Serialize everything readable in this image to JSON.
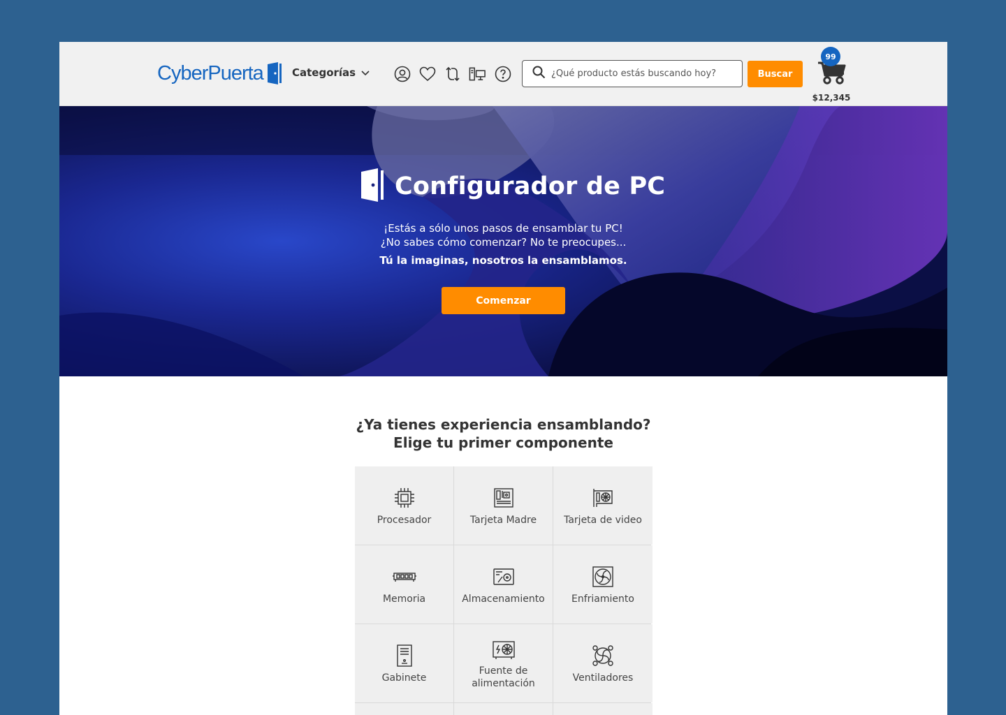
{
  "header": {
    "logo_text": "CyberPuerta",
    "categories_label": "Categorías",
    "icons": [
      "user-icon",
      "heart-icon",
      "compare-icon",
      "pc-config-icon",
      "help-icon"
    ],
    "search_placeholder": "¿Qué producto estás buscando hoy?",
    "search_button": "Buscar",
    "cart_count": "99",
    "cart_total": "$12,345"
  },
  "hero": {
    "title": "Configurador de PC",
    "line1": "¡Estás a sólo unos pasos de ensamblar tu PC!",
    "line2": "¿No sabes cómo comenzar? No te preocupes...",
    "line3": "Tú la imaginas, nosotros la ensamblamos.",
    "cta": "Comenzar"
  },
  "components": {
    "title_line1": "¿Ya tienes experiencia ensamblando?",
    "title_line2": "Elige tu primer componente",
    "items": [
      {
        "label": "Procesador",
        "icon": "cpu-icon"
      },
      {
        "label": "Tarjeta Madre",
        "icon": "motherboard-icon"
      },
      {
        "label": "Tarjeta de video",
        "icon": "gpu-icon"
      },
      {
        "label": "Memoria",
        "icon": "ram-icon"
      },
      {
        "label": "Almacenamiento",
        "icon": "storage-icon"
      },
      {
        "label": "Enfriamiento",
        "icon": "cooling-icon"
      },
      {
        "label": "Gabinete",
        "icon": "case-icon"
      },
      {
        "label": "Fuente de alimentación",
        "icon": "power-supply-icon"
      },
      {
        "label": "Ventiladores",
        "icon": "fan-icon"
      }
    ]
  },
  "colors": {
    "background": "#2d6190",
    "accent": "#ff8c00",
    "brand": "#1565c0"
  }
}
